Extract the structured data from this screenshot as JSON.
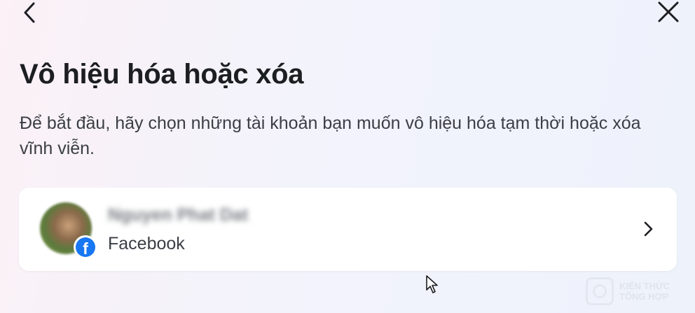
{
  "header": {
    "back_icon": "chevron-left-icon",
    "close_icon": "close-icon"
  },
  "page": {
    "title": "Vô hiệu hóa hoặc xóa",
    "description": "Để bắt đầu, hãy chọn những tài khoản bạn muốn vô hiệu hóa tạm thời hoặc xóa vĩnh viễn."
  },
  "account": {
    "name": "Nguyen Phat Dat",
    "platform": "Facebook",
    "badge_letter": "f",
    "badge_color": "#1877f2",
    "chevron_icon": "chevron-right-icon"
  },
  "watermark": {
    "line1": "KIẾN THỨC",
    "line2": "TỔNG HỢP"
  }
}
